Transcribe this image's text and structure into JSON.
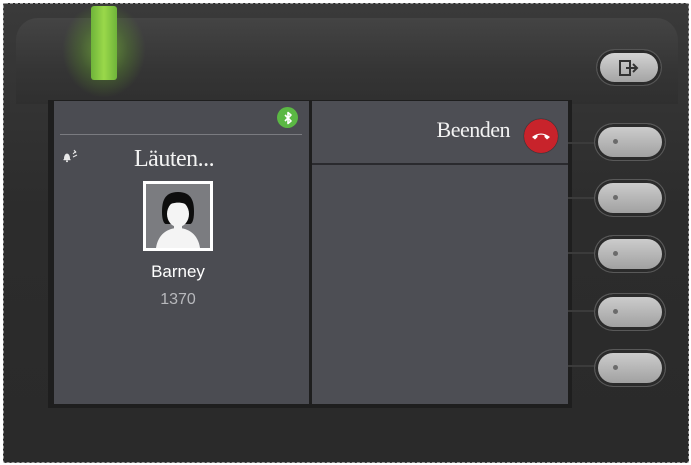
{
  "call": {
    "status": "Läuten...",
    "caller_name": "Barney",
    "caller_number": "1370",
    "ringing_icon": "bell-icon",
    "bluetooth_icon": "bluetooth-icon"
  },
  "actions": {
    "end_label": "Beenden",
    "end_icon": "hang-up-icon",
    "end_color": "#c8232b"
  },
  "hardware": {
    "led_color": "#8cd040",
    "exit_icon": "exit-icon",
    "softkey_count": 5
  }
}
